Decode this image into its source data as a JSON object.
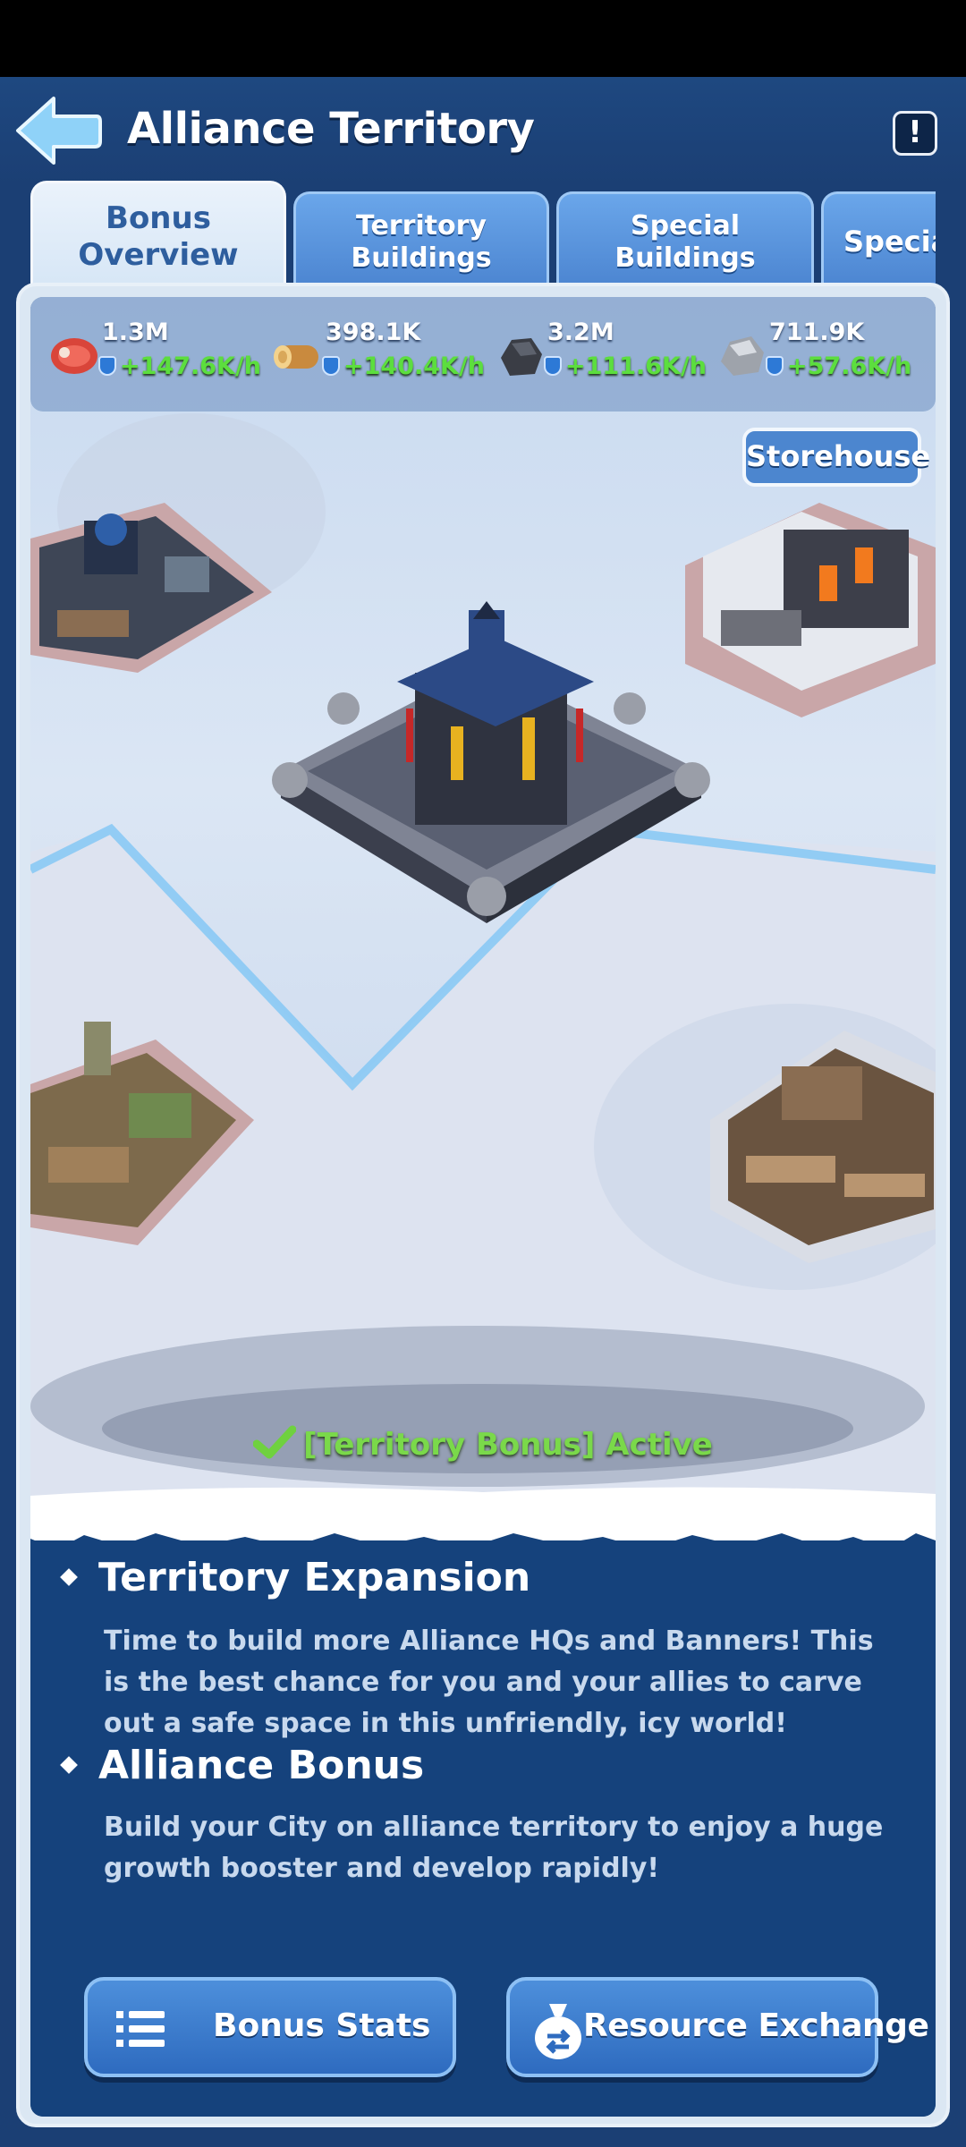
{
  "header": {
    "title": "Alliance Territory",
    "info_label": "!"
  },
  "tabs": [
    {
      "label": "Bonus Overview",
      "active": true
    },
    {
      "label": "Territory Buildings",
      "active": false
    },
    {
      "label": "Special Buildings",
      "active": false
    },
    {
      "label": "Specia",
      "active": false
    }
  ],
  "resources": [
    {
      "icon": "meat-icon",
      "amount": "1.3M",
      "rate": "+147.6K/h"
    },
    {
      "icon": "wood-icon",
      "amount": "398.1K",
      "rate": "+140.4K/h"
    },
    {
      "icon": "coal-icon",
      "amount": "3.2M",
      "rate": "+111.6K/h"
    },
    {
      "icon": "iron-ore-icon",
      "amount": "711.9K",
      "rate": "+57.6K/h"
    }
  ],
  "map": {
    "storehouse_label": "Storehouse",
    "bonus_status": "[Territory Bonus] Active"
  },
  "sections": [
    {
      "heading": "Territory Expansion",
      "body": "Time to build more Alliance HQs and Banners! This is the best chance for you and your allies to carve out a safe space in this unfriendly, icy world!"
    },
    {
      "heading": "Alliance Bonus",
      "body": "Build your City on alliance territory to enjoy a huge growth booster and develop rapidly!"
    }
  ],
  "buttons": {
    "bonus_stats": "Bonus Stats",
    "resource_exchange": "Resource Exchange"
  },
  "colors": {
    "accent_green": "#5cde3e",
    "panel_blue": "#15427c",
    "tab_blue": "#4b84d0"
  }
}
